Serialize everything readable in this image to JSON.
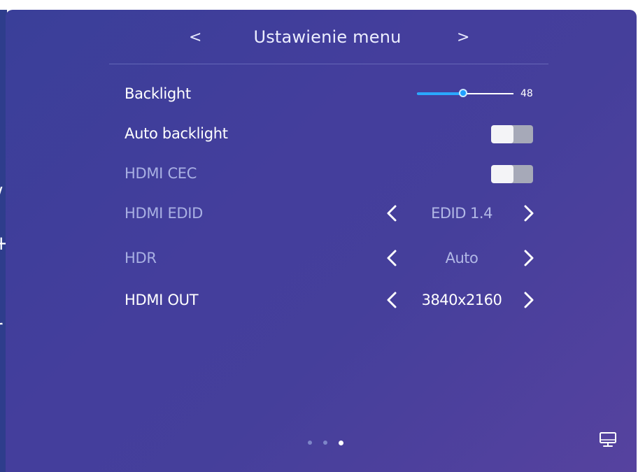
{
  "header": {
    "prev_glyph": "<",
    "title": "Ustawienie menu",
    "next_glyph": ">"
  },
  "rows": {
    "backlight": {
      "label": "Backlight",
      "value": "48",
      "level": 0.48
    },
    "auto_backlight": {
      "label": "Auto backlight",
      "state": "off"
    },
    "hdmi_cec": {
      "label": "HDMI CEC",
      "state": "off"
    },
    "hdmi_edid": {
      "label": "HDMI EDID",
      "value": "EDID 1.4"
    },
    "hdr": {
      "label": "HDR",
      "value": "Auto"
    },
    "hdmi_out": {
      "label": "HDMI OUT",
      "value": "3840x2160"
    }
  },
  "pager": {
    "count": 3,
    "active_index": 2
  },
  "icons": {
    "prev": "chevron-left-icon",
    "next": "chevron-right-icon",
    "monitor": "monitor-icon"
  },
  "colors": {
    "accent": "#2aa7ff",
    "panel_start": "#3a3f99",
    "panel_end": "#56429f",
    "dim_text": "#a9b0e3"
  }
}
